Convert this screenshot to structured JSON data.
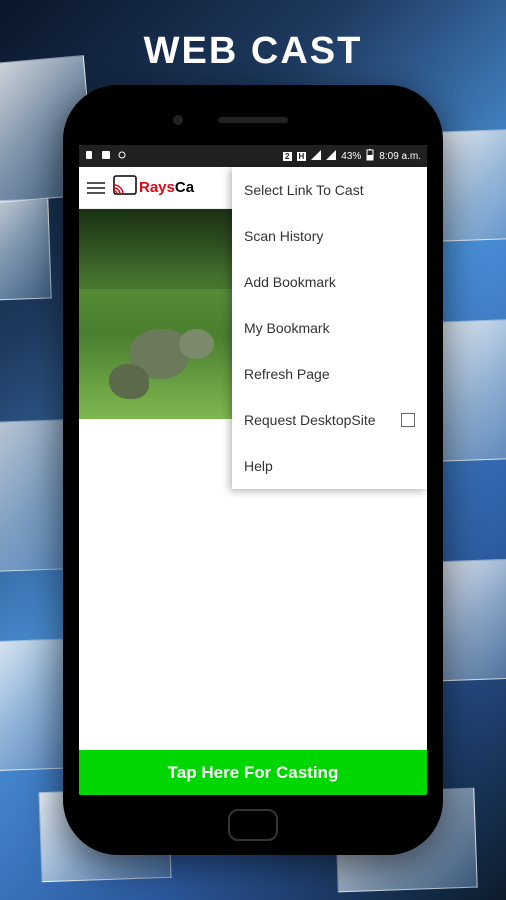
{
  "page_title": "WEB CAST",
  "status_bar": {
    "battery_pct": "43%",
    "time": "8:09 a.m.",
    "network_indicator": "2",
    "h_indicator": "H"
  },
  "header": {
    "logo_prefix": "Rays",
    "logo_suffix": "Ca"
  },
  "menu": {
    "items": [
      {
        "label": "Select Link To Cast"
      },
      {
        "label": "Scan History"
      },
      {
        "label": "Add Bookmark"
      },
      {
        "label": "My Bookmark"
      },
      {
        "label": "Refresh Page"
      },
      {
        "label": "Request DesktopSite",
        "has_checkbox": true
      },
      {
        "label": "Help"
      }
    ]
  },
  "cast_button_label": "Tap Here For Casting",
  "colors": {
    "accent_red": "#e30613",
    "cast_green": "#00d600"
  }
}
